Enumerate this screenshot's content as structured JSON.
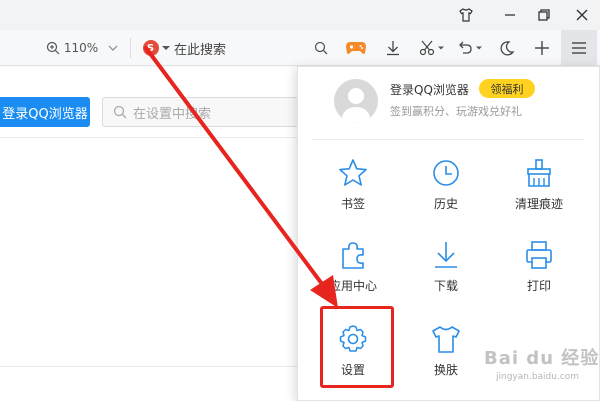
{
  "toolbar": {
    "zoom_level": "110%",
    "search_placeholder": "在此搜索"
  },
  "settings": {
    "login_button": "登录QQ浏览器",
    "search_placeholder": "在设置中搜索"
  },
  "menu": {
    "login_title": "登录QQ浏览器",
    "welfare_badge": "领福利",
    "login_subtitle": "签到赢积分、玩游戏兑好礼",
    "items": [
      {
        "label": "书签"
      },
      {
        "label": "历史"
      },
      {
        "label": "清理痕迹"
      },
      {
        "label": "应用中心"
      },
      {
        "label": "下载"
      },
      {
        "label": "打印"
      },
      {
        "label": "设置"
      },
      {
        "label": "换肤"
      }
    ]
  },
  "watermark": {
    "text": "Bai du 经验",
    "url": "jingyan.baidu.com"
  },
  "colors": {
    "accent": "#1b8cf2",
    "highlight": "#e8241f",
    "welfare": "#ffd21f"
  }
}
